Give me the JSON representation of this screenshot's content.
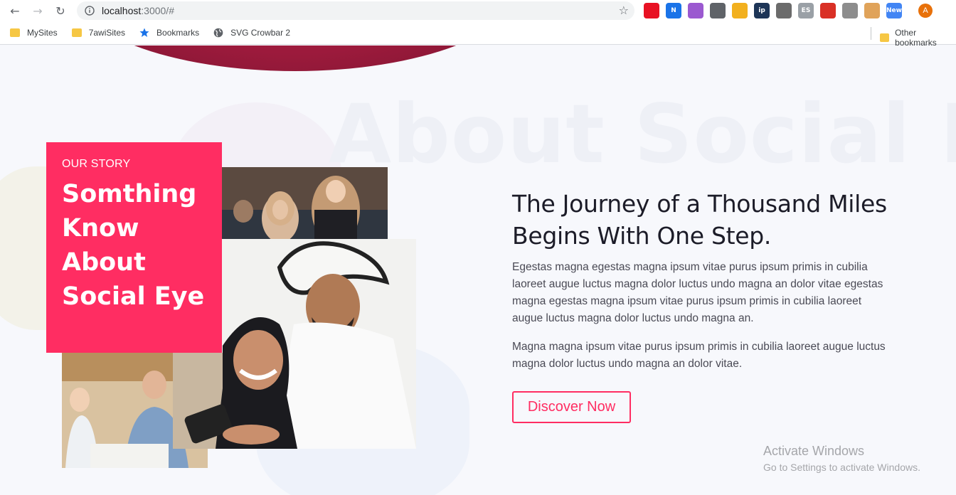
{
  "browser": {
    "url_host": "localhost",
    "url_rest": ":3000/#",
    "bookmarks": [
      {
        "label": "MySites",
        "icon": "folder-icon"
      },
      {
        "label": "7awiSites",
        "icon": "folder-icon"
      },
      {
        "label": "Bookmarks",
        "icon": "star-icon"
      },
      {
        "label": "SVG Crowbar 2",
        "icon": "globe-icon"
      }
    ],
    "other_bookmarks": "Other bookmarks",
    "avatar_initial": "A",
    "extensions": [
      {
        "name": "opera-extension-icon",
        "color": "#e81123",
        "glyph": ""
      },
      {
        "name": "notion-extension-icon",
        "color": "#1a73e8",
        "glyph": "N"
      },
      {
        "name": "feather-extension-icon",
        "color": "#9b59d0",
        "glyph": ""
      },
      {
        "name": "eyedropper-extension-icon",
        "color": "#5f6368",
        "glyph": ""
      },
      {
        "name": "ruler-extension-icon",
        "color": "#f2b01e",
        "glyph": ""
      },
      {
        "name": "ip-extension-icon",
        "color": "#1d3557",
        "glyph": "ip"
      },
      {
        "name": "gear-extension-icon",
        "color": "#6b6b6b",
        "glyph": ""
      },
      {
        "name": "es-extension-icon",
        "color": "#9aa0a6",
        "glyph": "ES"
      },
      {
        "name": "red-extension-icon",
        "color": "#d93025",
        "glyph": ""
      },
      {
        "name": "android-extension-icon",
        "color": "#8d8d8d",
        "glyph": ""
      },
      {
        "name": "character-extension-icon",
        "color": "#e0a35a",
        "glyph": ""
      },
      {
        "name": "new-extension-icon",
        "color": "#4285f4",
        "glyph": "New"
      }
    ]
  },
  "page": {
    "bg_title": "About Social Eye",
    "story": {
      "kicker": "OUR STORY",
      "title": "Somthing Know About Social Eye"
    },
    "headline": "The Journey of a Thousand Miles Begins With One Step.",
    "paragraph1": "Egestas magna egestas magna ipsum vitae purus ipsum primis in cubilia laoreet augue luctus magna dolor luctus undo magna an dolor vitae egestas magna egestas magna ipsum vitae purus ipsum primis in cubilia laoreet augue luctus magna dolor luctus undo magna an.",
    "paragraph2": "Magna magna ipsum vitae purus ipsum primis in cubilia laoreet augue luctus magna dolor luctus undo magna an dolor vitae.",
    "cta_label": "Discover Now",
    "accent_color": "#ff2d62"
  },
  "windows": {
    "activate_title": "Activate Windows",
    "activate_subtitle": "Go to Settings to activate Windows."
  }
}
